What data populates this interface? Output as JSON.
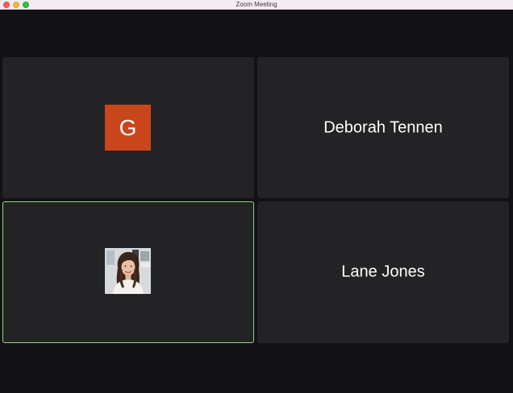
{
  "window": {
    "title": "Zoom Meeting"
  },
  "participants": [
    {
      "type": "initial-avatar",
      "initial": "G",
      "avatar_color": "#c9451b"
    },
    {
      "type": "name",
      "name": "Deborah Tennen"
    },
    {
      "type": "photo-avatar",
      "active_speaker": true,
      "highlight_color": "#8fdc7a"
    },
    {
      "type": "name",
      "name": "Lane Jones"
    }
  ]
}
